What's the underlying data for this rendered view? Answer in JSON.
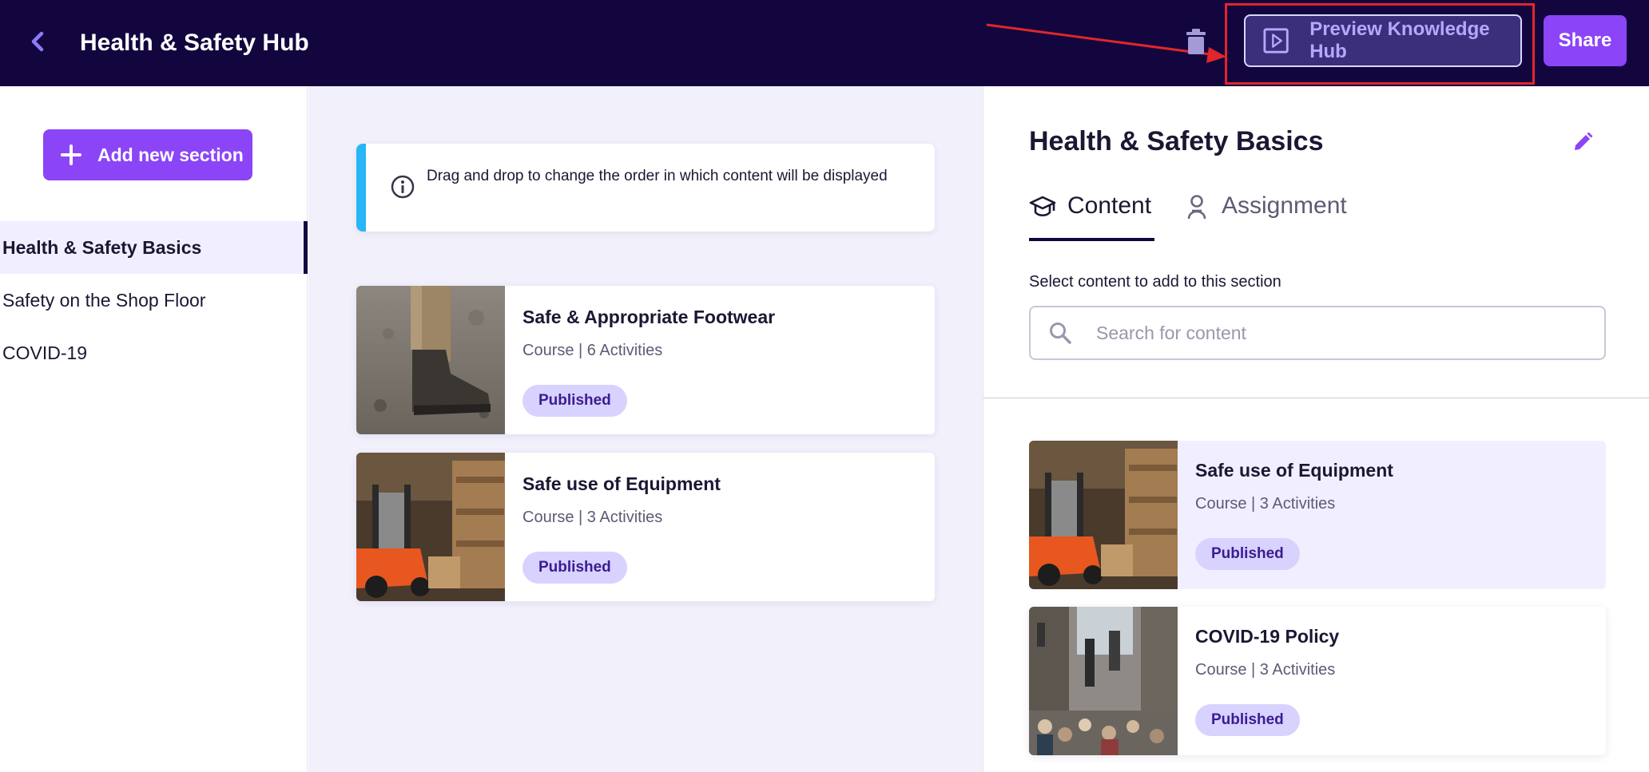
{
  "header": {
    "title": "Health & Safety Hub",
    "preview_label": "Preview Knowledge Hub",
    "share_label": "Share",
    "icons": {
      "back": "chevron-left-icon",
      "delete": "trash-icon",
      "preview": "play-square-icon"
    },
    "annotation_color": "#e0262b"
  },
  "sidebar": {
    "add_section_label": "Add new section",
    "items": [
      {
        "label": "Health & Safety Basics",
        "active": true
      },
      {
        "label": "Safety on the Shop Floor",
        "active": false
      },
      {
        "label": "COVID-19",
        "active": false
      }
    ]
  },
  "middle": {
    "info_text": "Drag and drop to change the order in which content will be displayed",
    "cards": [
      {
        "title": "Safe & Appropriate Footwear",
        "type": "Course",
        "activities": "6 Activities",
        "status": "Published",
        "image": "boots-photo"
      },
      {
        "title": "Safe use of Equipment",
        "type": "Course",
        "activities": "3 Activities",
        "status": "Published",
        "image": "forklift-photo"
      }
    ]
  },
  "panel": {
    "section_title": "Health & Safety Basics",
    "tabs": [
      {
        "label": "Content",
        "icon": "graduation-cap-icon",
        "active": true
      },
      {
        "label": "Assignment",
        "icon": "person-icon",
        "active": false
      }
    ],
    "select_label": "Select content to add to this section",
    "search_placeholder": "Search for content",
    "search_value": "",
    "results": [
      {
        "title": "Safe use of Equipment",
        "type": "Course",
        "activities": "3 Activities",
        "status": "Published",
        "image": "forklift-photo",
        "selected": true
      },
      {
        "title": "COVID-19 Policy",
        "type": "Course",
        "activities": "3 Activities",
        "status": "Published",
        "image": "city-street-photo",
        "selected": false
      }
    ]
  },
  "colors": {
    "header_bg": "#13063f",
    "accent": "#8b45f7",
    "badge_bg": "#d8d2ff",
    "info_border": "#29b6f6"
  }
}
